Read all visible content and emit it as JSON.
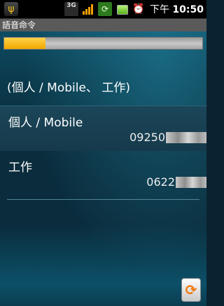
{
  "status_bar": {
    "usb_icon": "usb-debug-icon",
    "network_label": "3G",
    "time_period": "下午",
    "time": "10:50",
    "icons": [
      "3g-icon",
      "signal-icon",
      "sync-icon",
      "battery-icon",
      "alarm-icon"
    ]
  },
  "title_bar": {
    "title": "語音命令"
  },
  "progress": {
    "fraction": 0.21
  },
  "heading": "(個人 / Mobile、 工作)",
  "entries": [
    {
      "label": "個人 / Mobile",
      "number_visible": "09250"
    },
    {
      "label": "工作",
      "number_visible": "0622"
    }
  ],
  "colors": {
    "progress": "#f0a800",
    "accent_refresh": "#f07a10"
  }
}
